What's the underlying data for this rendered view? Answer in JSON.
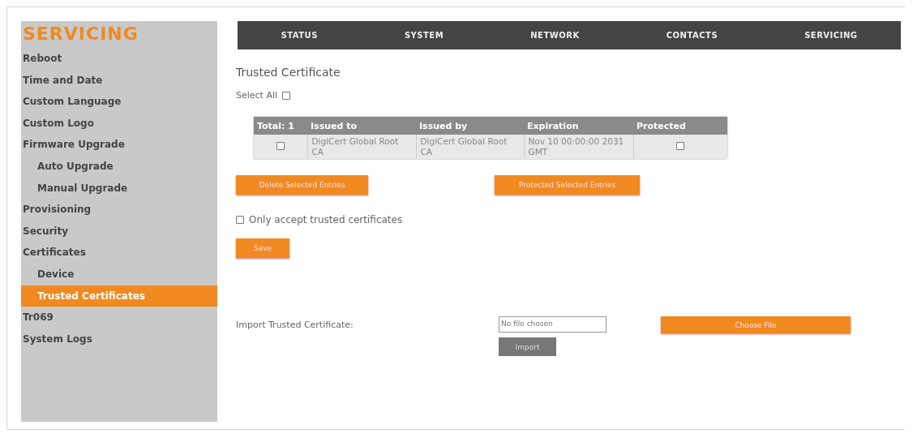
{
  "sidebar": {
    "title": "SERVICING",
    "items": [
      {
        "label": "Reboot",
        "selected": false
      },
      {
        "label": "Time and Date",
        "selected": false
      },
      {
        "label": "Custom Language",
        "selected": false
      },
      {
        "label": "Custom Logo",
        "selected": false
      },
      {
        "label": "Firmware Upgrade",
        "selected": false,
        "children": [
          {
            "label": "Auto Upgrade",
            "selected": false
          },
          {
            "label": "Manual Upgrade",
            "selected": false
          }
        ]
      },
      {
        "label": "Provisioning",
        "selected": false
      },
      {
        "label": "Security",
        "selected": false
      },
      {
        "label": "Certificates",
        "selected": false,
        "children": [
          {
            "label": "Device",
            "selected": false
          },
          {
            "label": "Trusted Certificates",
            "selected": true
          }
        ]
      },
      {
        "label": "Tr069",
        "selected": false
      },
      {
        "label": "System Logs",
        "selected": false
      }
    ]
  },
  "nav": [
    "STATUS",
    "SYSTEM",
    "NETWORK",
    "CONTACTS",
    "SERVICING"
  ],
  "page_title": "Trusted Certificate",
  "select_all": {
    "label": "Select All",
    "checked": false
  },
  "table": {
    "columns": [
      "Total: 1",
      "Issued to",
      "Issued by",
      "Expiration",
      "Protected"
    ],
    "rows": [
      {
        "checked": false,
        "issued_to": "DigiCert Global Root CA",
        "issued_by": "DigiCert Global Root CA",
        "expiration": "Nov 10 00:00:00 2031 GMT",
        "protected": false
      }
    ]
  },
  "actions": [
    "Delete Selected Entries",
    "Protected Selected Entries"
  ],
  "only_trusted": {
    "label": "Only accept trusted certificates",
    "checked": false
  },
  "save_button": "Save",
  "import": {
    "label": "Import Trusted Certificate:",
    "file_value": "No file chosen",
    "choose_button": "Choose File",
    "import_button": "Import"
  }
}
